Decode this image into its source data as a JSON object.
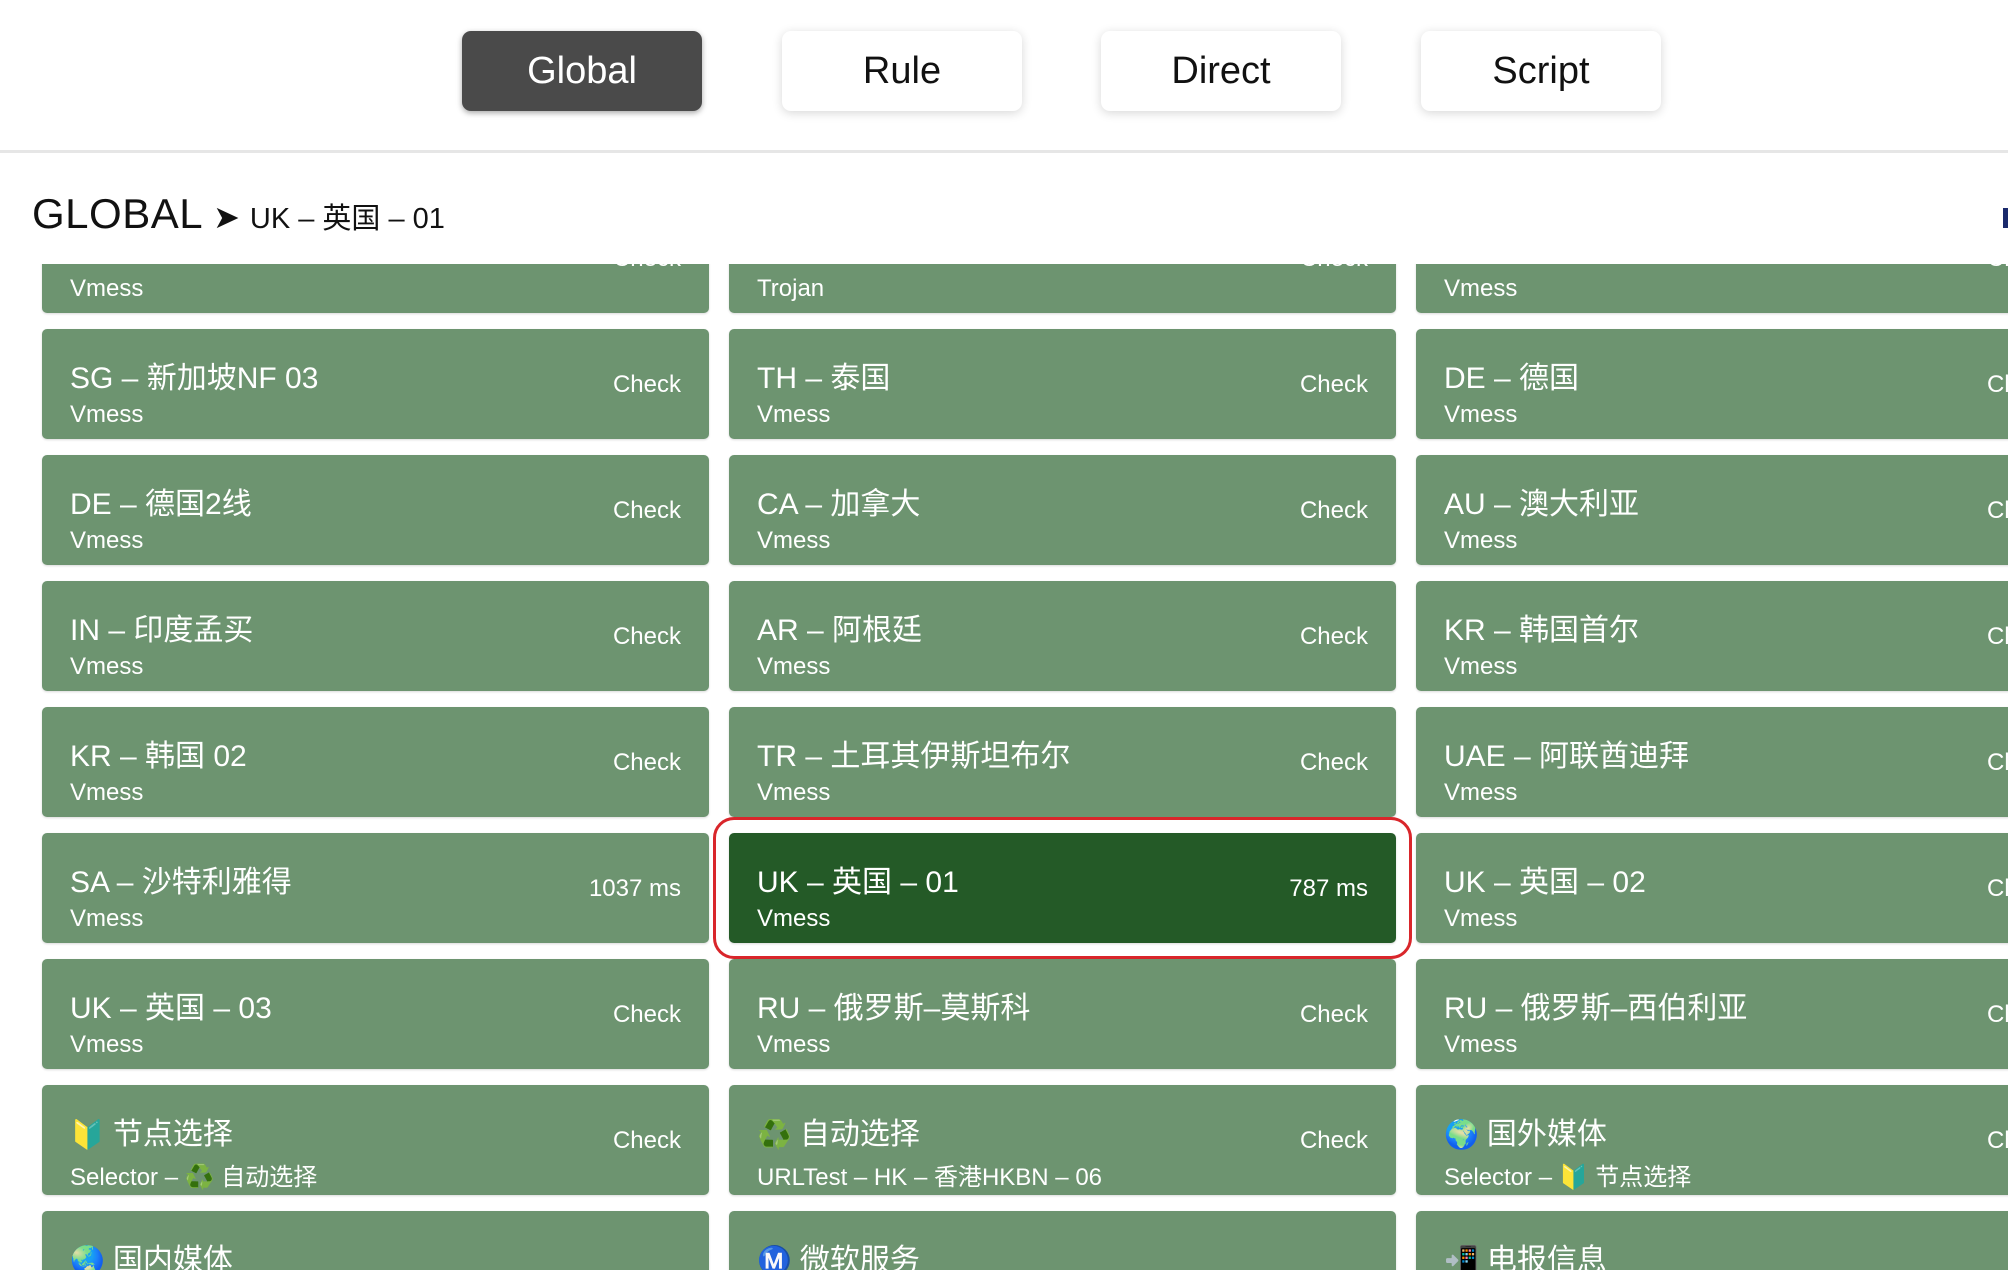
{
  "modes": [
    {
      "label": "Global",
      "active": true
    },
    {
      "label": "Rule",
      "active": false
    },
    {
      "label": "Direct",
      "active": false
    },
    {
      "label": "Script",
      "active": false
    }
  ],
  "group": {
    "title": "GLOBAL",
    "arrow": "➤",
    "selected": "UK – 英国 – 01"
  },
  "proxies": [
    {
      "name": "",
      "type": "Vmess",
      "delay": "Check"
    },
    {
      "name": "",
      "type": "Trojan",
      "delay": "Check"
    },
    {
      "name": "",
      "type": "Vmess",
      "delay": "Check"
    },
    {
      "name": "SG – 新加坡NF 03",
      "type": "Vmess",
      "delay": "Check"
    },
    {
      "name": "TH – 泰国",
      "type": "Vmess",
      "delay": "Check"
    },
    {
      "name": "DE – 德国",
      "type": "Vmess",
      "delay": "Check"
    },
    {
      "name": "DE – 德国2线",
      "type": "Vmess",
      "delay": "Check"
    },
    {
      "name": "CA – 加拿大",
      "type": "Vmess",
      "delay": "Check"
    },
    {
      "name": "AU – 澳大利亚",
      "type": "Vmess",
      "delay": "Check"
    },
    {
      "name": "IN – 印度孟买",
      "type": "Vmess",
      "delay": "Check"
    },
    {
      "name": "AR – 阿根廷",
      "type": "Vmess",
      "delay": "Check"
    },
    {
      "name": "KR – 韩国首尔",
      "type": "Vmess",
      "delay": "Check"
    },
    {
      "name": "KR – 韩国 02",
      "type": "Vmess",
      "delay": "Check"
    },
    {
      "name": "TR – 土耳其伊斯坦布尔",
      "type": "Vmess",
      "delay": "Check"
    },
    {
      "name": "UAE – 阿联酋迪拜",
      "type": "Vmess",
      "delay": "Check"
    },
    {
      "name": "SA – 沙特利雅得",
      "type": "Vmess",
      "delay": "1037 ms"
    },
    {
      "name": "UK – 英国 – 01",
      "type": "Vmess",
      "delay": "787 ms",
      "selected": true
    },
    {
      "name": "UK – 英国 – 02",
      "type": "Vmess",
      "delay": "Check"
    },
    {
      "name": "UK – 英国 – 03",
      "type": "Vmess",
      "delay": "Check"
    },
    {
      "name": "RU – 俄罗斯–莫斯科",
      "type": "Vmess",
      "delay": "Check"
    },
    {
      "name": "RU – 俄罗斯–西伯利亚",
      "type": "Vmess",
      "delay": "Check"
    },
    {
      "name": "节点选择",
      "icon": "🔰",
      "type": "Selector – ♻️ 自动选择",
      "delay": "Check"
    },
    {
      "name": "自动选择",
      "icon": "♻️",
      "type": "URLTest – HK – 香港HKBN – 06",
      "delay": "Check"
    },
    {
      "name": "国外媒体",
      "icon": "🌍",
      "type": "Selector – 🔰 节点选择",
      "delay": "Check"
    },
    {
      "name": "国内媒体",
      "icon": "🌏",
      "type": "",
      "delay": ""
    },
    {
      "name": "微软服务",
      "icon": "Ⓜ️",
      "type": "",
      "delay": ""
    },
    {
      "name": "电报信息",
      "icon": "📲",
      "type": "",
      "delay": ""
    }
  ],
  "colors": {
    "card": "#6d9470",
    "card_selected": "#245a27",
    "highlight_outline": "#d9262b",
    "active_mode": "#4a4a4a"
  }
}
